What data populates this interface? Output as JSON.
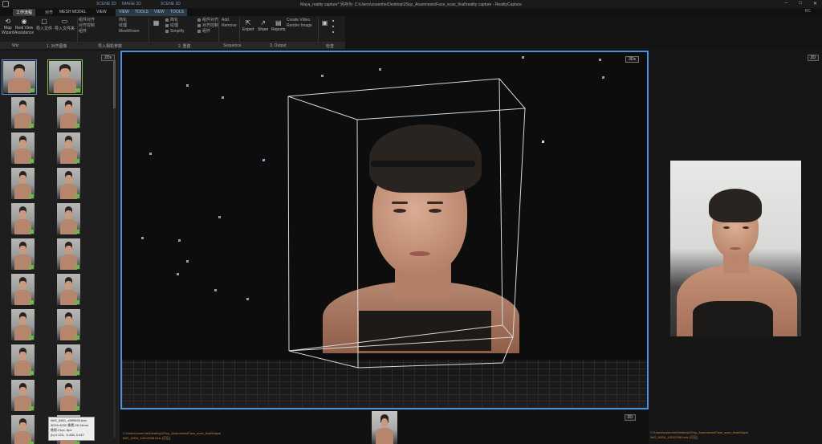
{
  "window": {
    "title": "Maya_reality capture* 另存为: C:\\Users\\zouenhe\\Desktop\\2Scp_Anamnesis\\Face_scan_final\\reality capture - RealityCapture",
    "top_right": "RC"
  },
  "tabs": {
    "items": [
      "工作流程",
      "对齐",
      "MESH MODEL",
      "VIEW"
    ],
    "scenes": [
      "SCENE 2D",
      "IMAGE 2D",
      "SCENE 3D"
    ],
    "viewtabs": [
      "VIEW",
      "TOOLS",
      "VIEW",
      "TOOLS"
    ]
  },
  "ribbon": {
    "buttons": [
      {
        "label1": "Map",
        "label2": "Wizard",
        "icon": "sync-icon"
      },
      {
        "label1": "Real View",
        "label2": "Assistance",
        "icon": "eye-icon"
      },
      {
        "label1": "导入文件",
        "label2": "",
        "icon": "file-icon"
      },
      {
        "label1": "导入文件夹",
        "label2": "",
        "icon": "folder-icon"
      }
    ],
    "col1": [
      "组件对齐",
      "对齐控制",
      "组件"
    ],
    "col2": [
      "简化",
      "纹理",
      "MeshRoom"
    ],
    "simplify": "Simplify",
    "add": "Add",
    "remove": "Remove",
    "export": "Export",
    "share": "Share",
    "reports": "Reports",
    "create_video": "Create Video",
    "render_image": "Render Image",
    "groups": [
      "Wiz",
      "1. 对齐图像",
      "导入相机参数",
      "2. 重建",
      "Sequence",
      "3. Output",
      "检查"
    ]
  },
  "left_panel": {
    "badge": "2Ds",
    "tooltip_lines": [
      "IMG_A851_4599834.heic",
      "3024×4032 像素:26.14mm",
      "焦距:21px, 8px",
      "(b) 0.123, -0.438, 0.447"
    ]
  },
  "viewport": {
    "badge": "3Ds"
  },
  "bottom": {
    "badge": "2D",
    "path_line1": "C:\\Users\\zouenhe\\Desktop\\2Scp_Anamnesis\\Face_scan_final\\Maya\\",
    "path_line2": "IMG_A904_10312008.heic [可见]"
  },
  "right_panel": {
    "badge": "2D",
    "path_line1": "C:\\Users\\zouenhe\\Desktop\\2Scp_Anamnesis\\Face_scan_final\\Maya\\",
    "path_line2": "IMG_A904_10312008.heic [可见]"
  },
  "colors": {
    "accent": "#4c8ed9",
    "selected_green": "#7ec04e",
    "path_orange": "#c9883c"
  }
}
